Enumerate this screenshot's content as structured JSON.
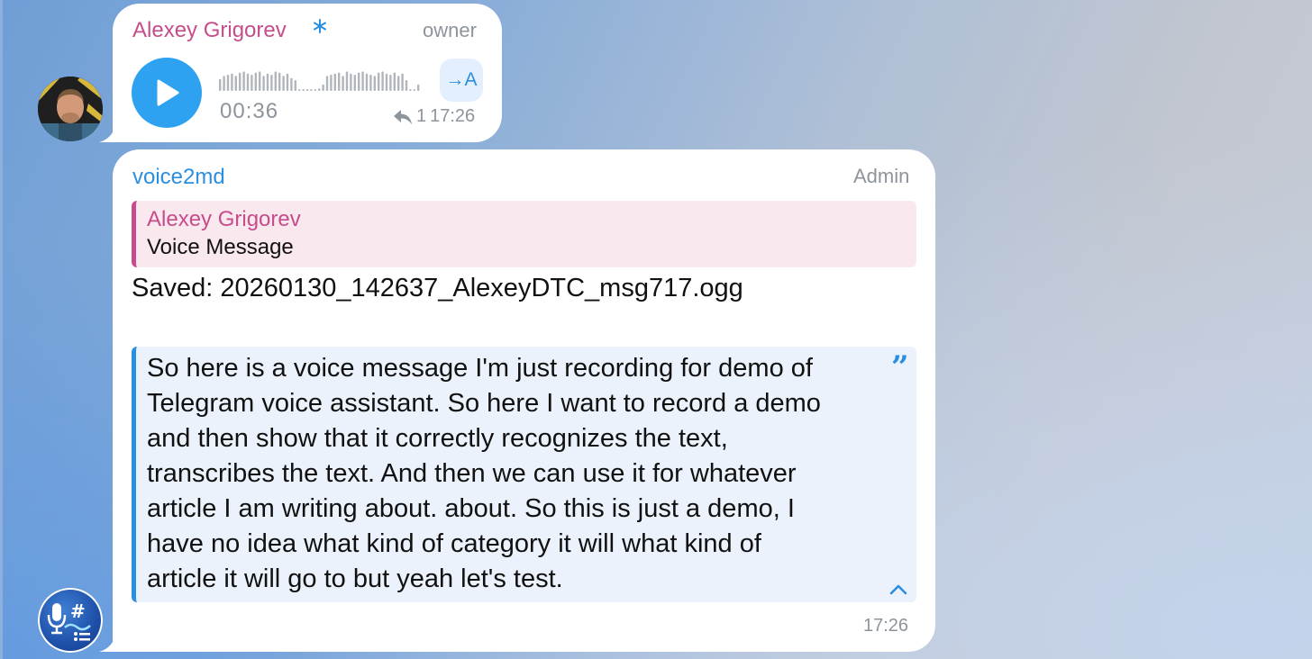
{
  "message_1": {
    "sender": "Alexey Grigorev",
    "role": "owner",
    "duration": "00:36",
    "transcribe_label": "→A",
    "reply_count": "1",
    "time": "17:26",
    "waveform_levels": [
      0.55,
      0.7,
      0.75,
      0.8,
      0.7,
      0.85,
      0.9,
      0.8,
      0.75,
      0.85,
      0.9,
      0.7,
      0.8,
      0.75,
      0.9,
      0.85,
      0.7,
      0.8,
      0.6,
      0.5,
      0.08,
      0.08,
      0.08,
      0.08,
      0.08,
      0.12,
      0.3,
      0.7,
      0.75,
      0.8,
      0.85,
      0.7,
      0.9,
      0.8,
      0.75,
      0.85,
      0.9,
      0.8,
      0.75,
      0.7,
      0.85,
      0.9,
      0.8,
      0.75,
      0.85,
      0.7,
      0.8,
      0.5,
      0.08,
      0.08,
      0.3
    ]
  },
  "message_2": {
    "sender": "voice2md",
    "role": "Admin",
    "reply": {
      "author": "Alexey Grigorev",
      "text": "Voice Message"
    },
    "saved_line": "Saved: 20260130_142637_AlexeyDTC_msg717.ogg",
    "transcript": "So here is a voice message I'm just recording for demo of\nTelegram voice assistant. So here I want to record a demo\nand then show that it correctly recognizes the text,\ntranscribes the text. And then we can use it for whatever\narticle I am writing about. about. So this is just a demo, I\nhave no idea what kind of category it will what kind of\narticle it will go to but yeah let's test.",
    "quote_mark": "”",
    "time": "17:26"
  },
  "colors": {
    "owner_name": "#c64d8b",
    "bot_name": "#2a8fe0",
    "accent": "#2ea2f1",
    "meta_gray": "#8d949b"
  },
  "icons": {
    "play": "play-icon",
    "reply": "reply-arrow-icon",
    "collapse": "chevron-up-icon",
    "premium": "snowflake-badge-icon"
  }
}
